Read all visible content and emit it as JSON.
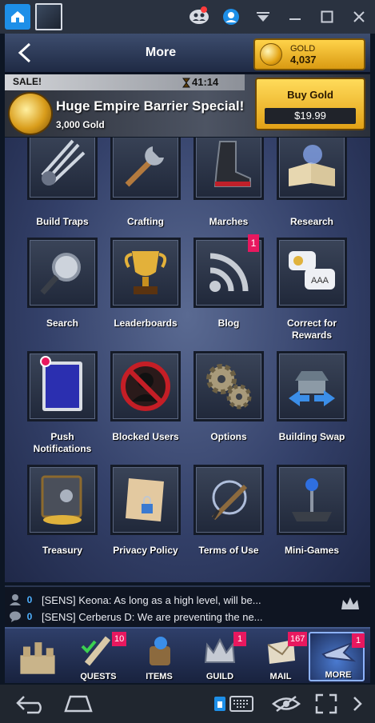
{
  "emulator": {
    "icons": [
      "home-icon",
      "app-thumbnail",
      "multi-user-icon",
      "account-icon",
      "dropdown-icon",
      "minimize-icon",
      "maximize-icon",
      "close-icon"
    ],
    "notification_dot_color": "#ff3b3b"
  },
  "header": {
    "title": "More",
    "gold_label": "GOLD",
    "gold_value": "4,037"
  },
  "sale": {
    "tag": "SALE!",
    "timer": "41:14",
    "title": "Huge Empire Barrier Special!",
    "subtitle": "3,000 Gold",
    "buy_label": "Buy Gold",
    "price": "$19.99"
  },
  "grid": [
    {
      "label": "Build Traps",
      "icon": "claws-icon",
      "badge": null
    },
    {
      "label": "Crafting",
      "icon": "wrench-icon",
      "badge": null
    },
    {
      "label": "Marches",
      "icon": "boot-icon",
      "badge": null
    },
    {
      "label": "Research",
      "icon": "book-icon",
      "badge": null
    },
    {
      "label": "Search",
      "icon": "magnifier-icon",
      "badge": null
    },
    {
      "label": "Leaderboards",
      "icon": "trophy-icon",
      "badge": null
    },
    {
      "label": "Blog",
      "icon": "rss-icon",
      "badge": "1"
    },
    {
      "label": "Correct for Rewards",
      "icon": "chat-bubbles-icon",
      "badge": null
    },
    {
      "label": "Push Notifications",
      "icon": "phone-icon",
      "badge": null
    },
    {
      "label": "Blocked Users",
      "icon": "blocked-user-icon",
      "badge": null
    },
    {
      "label": "Options",
      "icon": "gears-icon",
      "badge": null
    },
    {
      "label": "Building Swap",
      "icon": "building-swap-icon",
      "badge": null
    },
    {
      "label": "Treasury",
      "icon": "vault-icon",
      "badge": null
    },
    {
      "label": "Privacy Policy",
      "icon": "locked-scroll-icon",
      "badge": null
    },
    {
      "label": "Terms of Use",
      "icon": "quill-icon",
      "badge": null
    },
    {
      "label": "Mini-Games",
      "icon": "joystick-icon",
      "badge": null
    }
  ],
  "chat": {
    "rows": [
      {
        "count": "0",
        "icon": "people-icon",
        "message": "[SENS] Keona: As long as a high level, will be..."
      },
      {
        "count": "0",
        "icon": "chat-icon",
        "message": "[SENS] Cerberus  D: We are preventing the ne..."
      }
    ]
  },
  "nav": [
    {
      "label": "",
      "icon": "castle-icon",
      "badge": null
    },
    {
      "label": "QUESTS",
      "icon": "quests-icon",
      "badge": "10"
    },
    {
      "label": "ITEMS",
      "icon": "items-bag-icon",
      "badge": null
    },
    {
      "label": "GUILD",
      "icon": "guild-crown-icon",
      "badge": "1"
    },
    {
      "label": "MAIL",
      "icon": "mail-icon",
      "badge": "167"
    },
    {
      "label": "MORE",
      "icon": "more-icon",
      "badge": "1"
    }
  ],
  "android": {
    "icons": [
      "back-icon",
      "home-icon",
      "keyboard-icon",
      "visibility-icon",
      "fullscreen-icon",
      "next-icon"
    ]
  },
  "colors": {
    "badge": "#e8185f",
    "gold": "#ffd34a",
    "chat_count": "#4fb1ff"
  }
}
